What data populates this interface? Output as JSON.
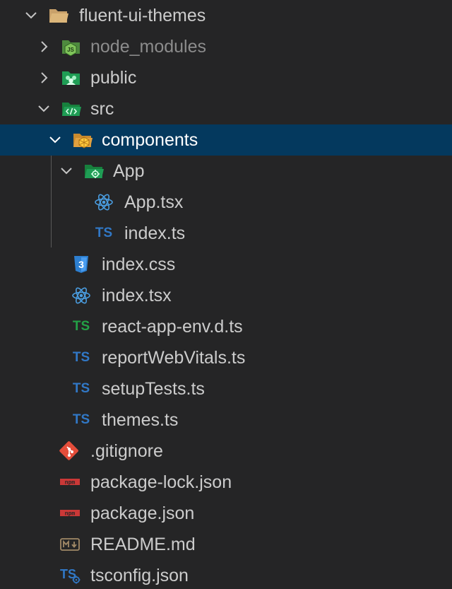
{
  "explorer": {
    "items": [
      {
        "label": "fluent-ui-themes"
      },
      {
        "label": "node_modules"
      },
      {
        "label": "public"
      },
      {
        "label": "src"
      },
      {
        "label": "components"
      },
      {
        "label": "App"
      },
      {
        "label": "App.tsx"
      },
      {
        "label": "index.ts"
      },
      {
        "label": "index.css"
      },
      {
        "label": "index.tsx"
      },
      {
        "label": "react-app-env.d.ts"
      },
      {
        "label": "reportWebVitals.ts"
      },
      {
        "label": "setupTests.ts"
      },
      {
        "label": "themes.ts"
      },
      {
        "label": ".gitignore"
      },
      {
        "label": "package-lock.json"
      },
      {
        "label": "package.json"
      },
      {
        "label": "README.md"
      },
      {
        "label": "tsconfig.json"
      }
    ],
    "icons": {
      "ts_text": "TS",
      "npm_text": "npm",
      "md_text": "M↓"
    },
    "colors": {
      "background": "#252526",
      "selected_row": "#04395e",
      "ts_blue": "#3178c6",
      "ts_green": "#23a046",
      "react_blue": "#4a9de0",
      "css_blue": "#2d7fd0",
      "git_red": "#e44d3a",
      "npm_red": "#cb3837",
      "folder_green": "#2ea043",
      "folder_tan": "#c9a16a"
    }
  }
}
